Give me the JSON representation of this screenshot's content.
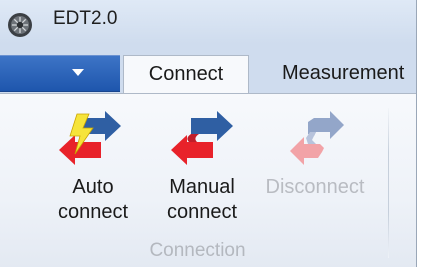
{
  "window": {
    "title": "EDT2.0"
  },
  "icons": {
    "app": "app-gear-icon",
    "file_menu": "file-menu-dropdown-icon"
  },
  "tabs": [
    {
      "label": "Connect",
      "active": true
    },
    {
      "label": "Measurement",
      "active": false
    }
  ],
  "ribbon": {
    "groups": [
      {
        "label": "Connection",
        "buttons": [
          {
            "line1": "Auto",
            "line2": "connect",
            "icon": "auto-connect-icon",
            "enabled": true
          },
          {
            "line1": "Manual",
            "line2": "connect",
            "icon": "manual-connect-icon",
            "enabled": true
          },
          {
            "line1": "Disconnect",
            "line2": "",
            "icon": "disconnect-icon",
            "enabled": false
          }
        ]
      }
    ]
  },
  "colors": {
    "ribbon_blue": "#2a62b8",
    "arrow_blue": "#2f5fa3",
    "arrow_red": "#e8222a",
    "bolt_yellow": "#f6e43a",
    "disabled_text": "#b9bcc2"
  }
}
